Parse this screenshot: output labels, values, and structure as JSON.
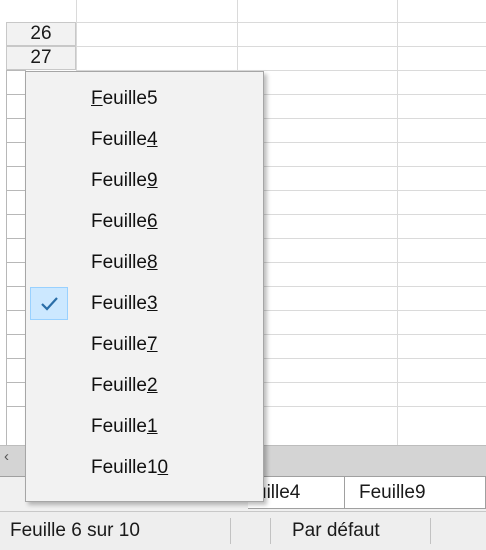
{
  "row_headers": [
    "26",
    "27"
  ],
  "sheet_menu": {
    "items": [
      {
        "prefix": "",
        "mnemonic": "F",
        "suffix": "euille5",
        "checked": false
      },
      {
        "prefix": "Feuille",
        "mnemonic": "4",
        "suffix": "",
        "checked": false
      },
      {
        "prefix": "Feuille",
        "mnemonic": "9",
        "suffix": "",
        "checked": false
      },
      {
        "prefix": "Feuille",
        "mnemonic": "6",
        "suffix": "",
        "checked": false
      },
      {
        "prefix": "Feuille",
        "mnemonic": "8",
        "suffix": "",
        "checked": false
      },
      {
        "prefix": "Feuille",
        "mnemonic": "3",
        "suffix": "",
        "checked": true
      },
      {
        "prefix": "Feuille",
        "mnemonic": "7",
        "suffix": "",
        "checked": false
      },
      {
        "prefix": "Feuille",
        "mnemonic": "2",
        "suffix": "",
        "checked": false
      },
      {
        "prefix": "Feuille",
        "mnemonic": "1",
        "suffix": "",
        "checked": false
      },
      {
        "prefix": "Feuille1",
        "mnemonic": "0",
        "suffix": "",
        "checked": false
      }
    ],
    "check_icon": "checkmark-icon",
    "check_highlight_color": "#cce8ff"
  },
  "sheet_tabs": [
    {
      "label": "uille4"
    },
    {
      "label": "Feuille9"
    }
  ],
  "status_bar": {
    "sheet_position": "Feuille 6 sur 10",
    "page_style": "Par défaut"
  },
  "scroll_left_icon": "arrow-left-icon"
}
